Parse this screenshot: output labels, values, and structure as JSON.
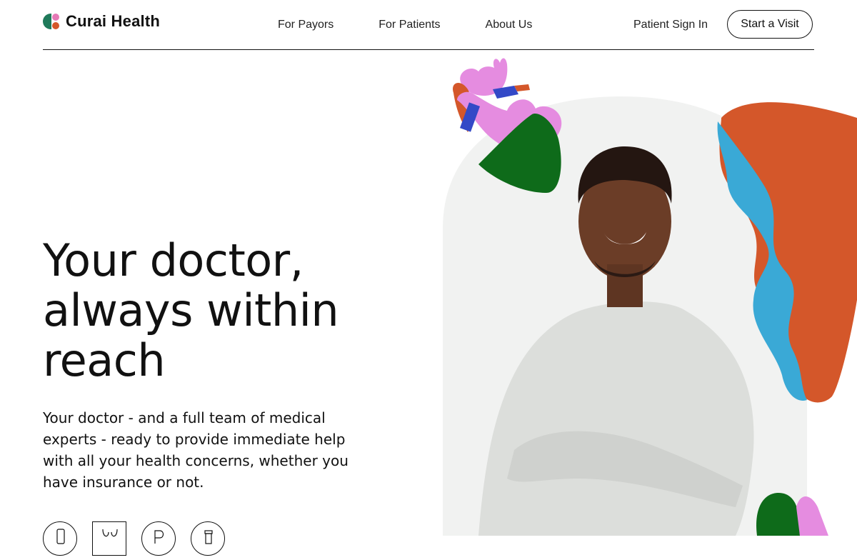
{
  "brand": {
    "name": "Curai Health"
  },
  "nav": {
    "items": [
      {
        "label": "For Payors"
      },
      {
        "label": "For Patients"
      },
      {
        "label": "About Us"
      }
    ],
    "signin_label": "Patient Sign In",
    "cta_label": "Start a Visit"
  },
  "hero": {
    "title_lines": [
      "Your doctor,",
      "always within",
      "reach"
    ],
    "subtitle": "Your doctor - and a full team of medical experts - ready to provide immediate help with all your health concerns, whether you have insurance or not."
  },
  "icons": {
    "features": [
      "phone-icon",
      "stethoscope-icon",
      "prescription-icon",
      "pill-bottle-icon"
    ]
  },
  "colors": {
    "brand_green": "#1f7a5a",
    "brand_pink": "#e57ab6",
    "brand_orange": "#d4572a",
    "illustration_blue": "#3aa9d6",
    "illustration_dark_green": "#0e6b1a"
  }
}
